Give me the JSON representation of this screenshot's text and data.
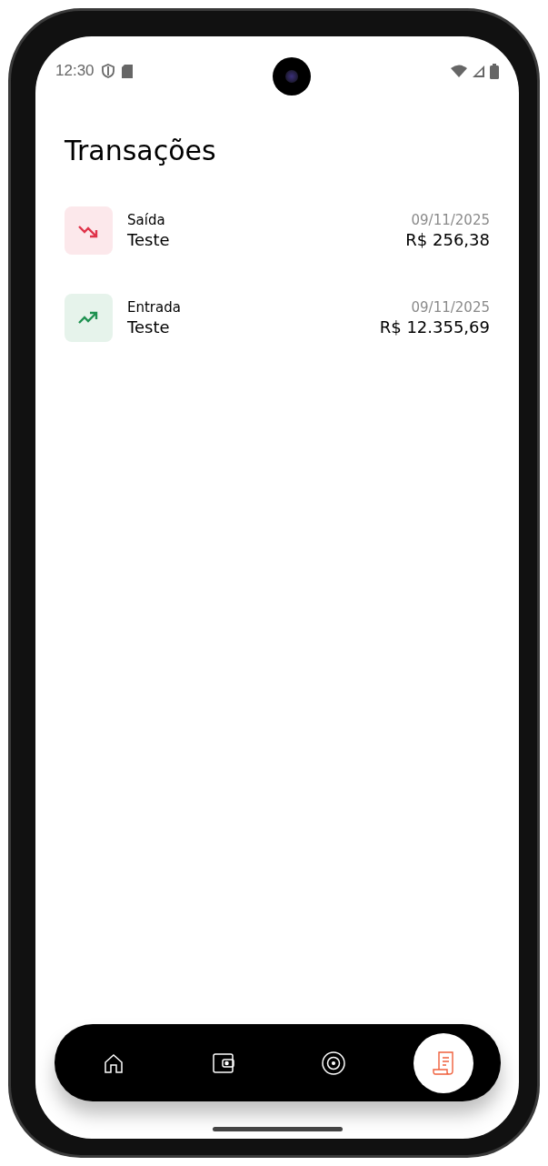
{
  "status_bar": {
    "time": "12:30"
  },
  "title": "Transações",
  "transactions": [
    {
      "kind": "out",
      "label": "Saída",
      "name": "Teste",
      "date": "09/11/2025",
      "amount": "R$ 256,38"
    },
    {
      "kind": "in",
      "label": "Entrada",
      "name": "Teste",
      "date": "09/11/2025",
      "amount": "R$ 12.355,69"
    }
  ],
  "nav": [
    {
      "kind": "home",
      "selected": false
    },
    {
      "kind": "wallet",
      "selected": false
    },
    {
      "kind": "target",
      "selected": false
    },
    {
      "kind": "receipt",
      "selected": true
    }
  ]
}
